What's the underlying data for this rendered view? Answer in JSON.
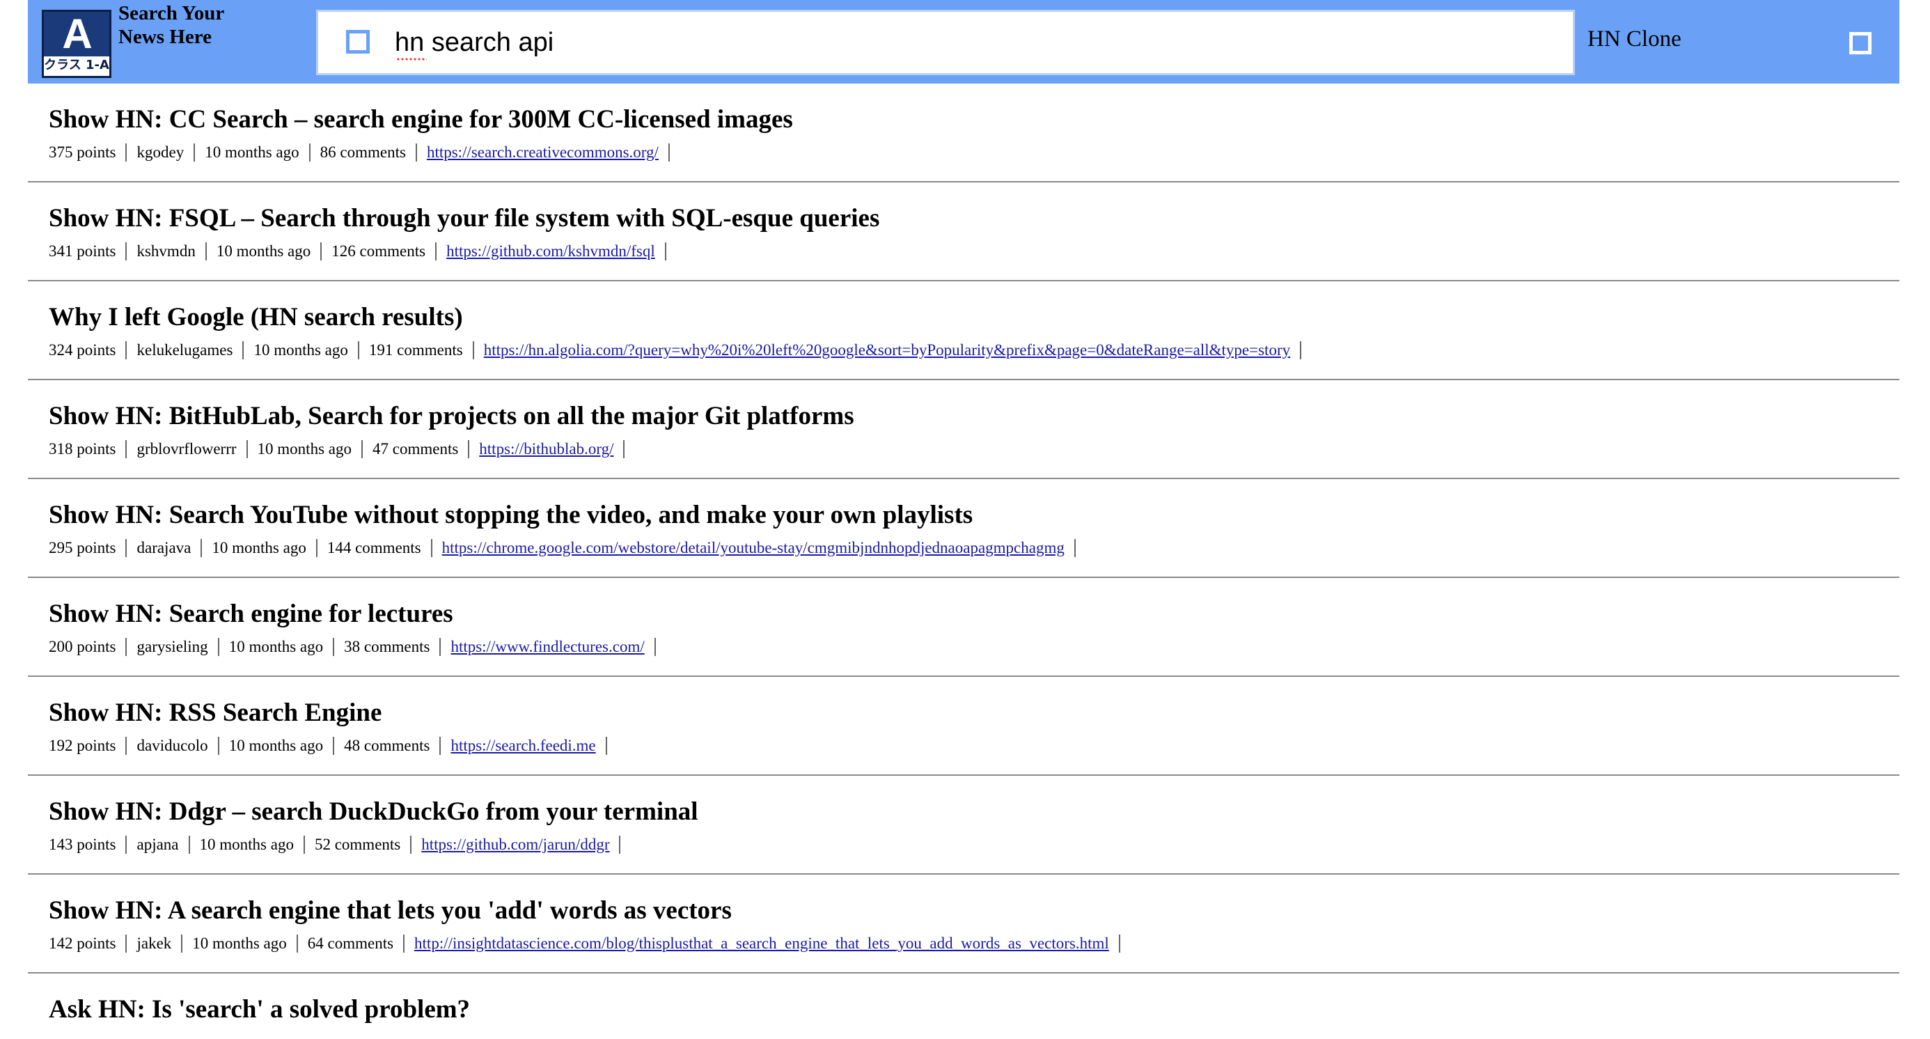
{
  "header": {
    "logo": {
      "main": "A",
      "sub": "クラス 1-A"
    },
    "site_title": "Search Your News Here",
    "search": {
      "value": "hn search api",
      "placeholder": ""
    },
    "right_label": "HN Clone",
    "colors": {
      "header_bg": "#6aa1f7",
      "link": "#1a1aa6"
    }
  },
  "results": [
    {
      "title": "Show HN: CC Search – search engine for 300M CC-licensed images",
      "points": "375 points",
      "author": "kgodey",
      "age": "10 months ago",
      "comments": "86 comments",
      "url": "https://search.creativecommons.org/"
    },
    {
      "title": "Show HN: FSQL – Search through your file system with SQL-esque queries",
      "points": "341 points",
      "author": "kshvmdn",
      "age": "10 months ago",
      "comments": "126 comments",
      "url": "https://github.com/kshvmdn/fsql"
    },
    {
      "title": "Why I left Google (HN search results)",
      "points": "324 points",
      "author": "kelukelugames",
      "age": "10 months ago",
      "comments": "191 comments",
      "url": "https://hn.algolia.com/?query=why%20i%20left%20google&sort=byPopularity&prefix&page=0&dateRange=all&type=story"
    },
    {
      "title": "Show HN: BitHubLab, Search for projects on all the major Git platforms",
      "points": "318 points",
      "author": "grblovrflowerrr",
      "age": "10 months ago",
      "comments": "47 comments",
      "url": "https://bithublab.org/"
    },
    {
      "title": "Show HN: Search YouTube without stopping the video, and make your own playlists",
      "points": "295 points",
      "author": "darajava",
      "age": "10 months ago",
      "comments": "144 comments",
      "url": "https://chrome.google.com/webstore/detail/youtube-stay/cmgmibjndnhopdjednaoapagmpchagmg"
    },
    {
      "title": "Show HN: Search engine for lectures",
      "points": "200 points",
      "author": "garysieling",
      "age": "10 months ago",
      "comments": "38 comments",
      "url": "https://www.findlectures.com/"
    },
    {
      "title": "Show HN: RSS Search Engine",
      "points": "192 points",
      "author": "daviducolo",
      "age": "10 months ago",
      "comments": "48 comments",
      "url": "https://search.feedi.me"
    },
    {
      "title": "Show HN: Ddgr – search DuckDuckGo from your terminal",
      "points": "143 points",
      "author": "apjana",
      "age": "10 months ago",
      "comments": "52 comments",
      "url": "https://github.com/jarun/ddgr"
    },
    {
      "title": "Show HN: A search engine that lets you 'add' words as vectors",
      "points": "142 points",
      "author": "jakek",
      "age": "10 months ago",
      "comments": "64 comments",
      "url": "http://insightdatascience.com/blog/thisplusthat_a_search_engine_that_lets_you_add_words_as_vectors.html"
    },
    {
      "title": "Ask HN: Is 'search' a solved problem?",
      "points": "",
      "author": "",
      "age": "",
      "comments": "",
      "url": ""
    }
  ]
}
